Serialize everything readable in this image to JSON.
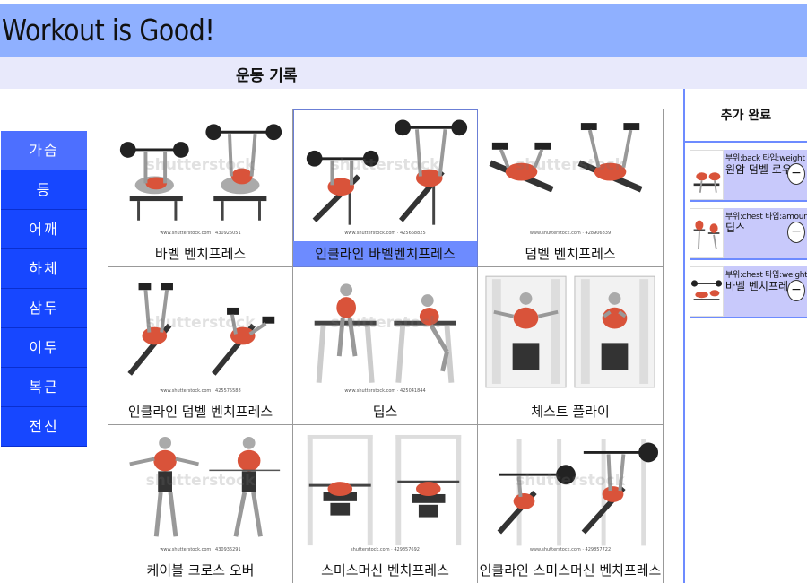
{
  "app": {
    "title": "Workout is Good!",
    "subtitle": "운동 기록"
  },
  "nav": {
    "items": [
      "가슴",
      "등",
      "어깨",
      "하체",
      "삼두",
      "이두",
      "복근",
      "전신"
    ],
    "active": "가슴"
  },
  "exercises": [
    {
      "label": "바벨 벤치프레스",
      "watermark": "shutterstock",
      "credit": "www.shutterstock.com · 430926051"
    },
    {
      "label": "인클라인 바벨벤치프레스",
      "watermark": "shutterstock",
      "credit": "www.shutterstock.com · 425668825",
      "selected": true
    },
    {
      "label": "덤벨 벤치프레스",
      "watermark": "shutterstock",
      "credit": "www.shutterstock.com · 428906839"
    },
    {
      "label": "인클라인 덤벨 벤치프레스",
      "watermark": "shutterstock",
      "credit": "www.shutterstock.com · 425575588"
    },
    {
      "label": "딥스",
      "watermark": "shutterstock",
      "credit": "www.shutterstock.com · 425041844"
    },
    {
      "label": "체스트 플라이",
      "watermark": "",
      "credit": ""
    },
    {
      "label": "케이블 크로스 오버",
      "watermark": "shutterstock",
      "credit": "www.shutterstock.com · 430936291"
    },
    {
      "label": "스미스머신 벤치프레스",
      "watermark": "",
      "credit": "shutterstock.com · 429857692"
    },
    {
      "label": "인클라인 스미스머신 벤치프레스",
      "watermark": "shutterstock",
      "credit": "www.shutterstock.com · 429857722"
    }
  ],
  "sidebar": {
    "done_label": "추가 완료",
    "records": [
      {
        "meta": "부위:back 타입:weight",
        "name": "원암 덤벨 로우",
        "remove": "−"
      },
      {
        "meta": "부위:chest 타입:amount",
        "name": "딥스",
        "remove": "−"
      },
      {
        "meta": "부위:chest 타입:weight",
        "name": "바벨 벤치프레스",
        "remove": "−"
      }
    ]
  },
  "colors": {
    "header": "#8fb0ff",
    "nav": "#1747ff",
    "accent": "#6d8bff",
    "record": "#c8c9fb"
  }
}
